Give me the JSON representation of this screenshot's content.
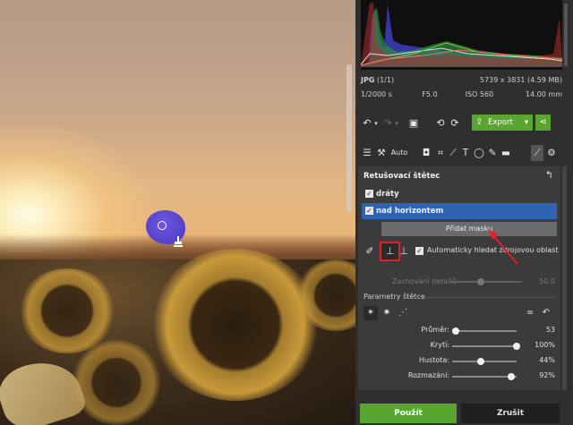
{
  "photo": {
    "description_icons": [
      "brush-spot",
      "stamp-cursor"
    ]
  },
  "info": {
    "format": "JPG",
    "count": "(1/1)",
    "dimensions": "5739 x 3831 (4.59 MB)",
    "shutter": "1/2000 s",
    "aperture": "F5.0",
    "iso": "ISO 560",
    "focal": "14.00 mm"
  },
  "toolbar": {
    "export_label": "Export",
    "auto_label": "Auto"
  },
  "section": {
    "title": "Retušovací štětec",
    "masks": [
      {
        "label": "dráty",
        "checked": true,
        "selected": false
      },
      {
        "label": "nad horizontem",
        "checked": true,
        "selected": true
      }
    ],
    "add_mask_label": "Přidat masku",
    "auto_find_label": "Automaticky hledat zdrojovou oblast",
    "detail_label": "Zachování detailů",
    "detail_value": "50.0",
    "params_title": "Parametry štětce",
    "sliders": [
      {
        "label": "Průměr:",
        "value": "53",
        "fraction": 0.05
      },
      {
        "label": "Krytí:",
        "value": "100%",
        "fraction": 1.0
      },
      {
        "label": "Hustota:",
        "value": "44%",
        "fraction": 0.44
      },
      {
        "label": "Rozmazání:",
        "value": "92%",
        "fraction": 0.92
      }
    ]
  },
  "bottom": {
    "apply_label": "Použít",
    "cancel_label": "Zrušit"
  },
  "colors": {
    "accent_green": "#58a52f",
    "selected_blue": "#2f64b5",
    "highlight_red": "#e1202a"
  }
}
